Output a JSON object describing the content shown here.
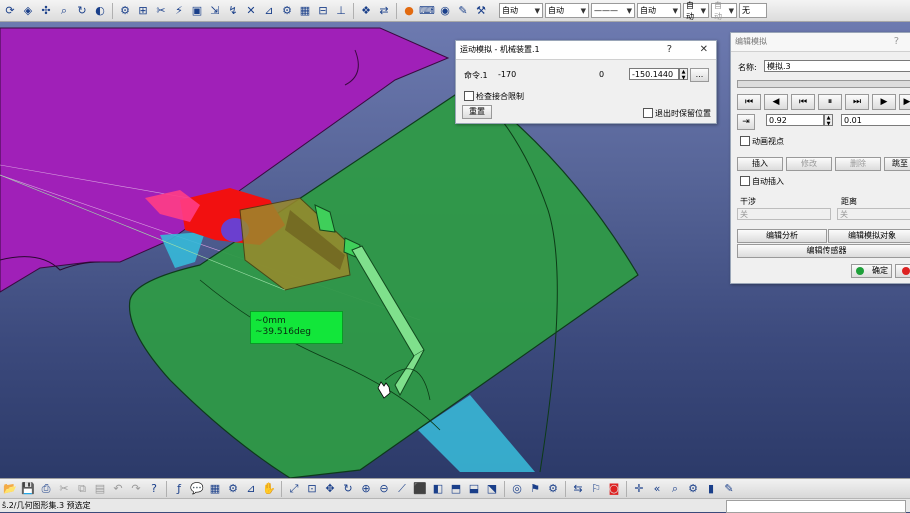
{
  "top_toolbar": {
    "icons": [
      "update-icon",
      "render-style-icon",
      "compass-icon",
      "zoom-fit-icon",
      "rotate-icon",
      "hide-show-icon",
      "assembly-icon",
      "constraint-icon",
      "snap-icon",
      "bolt-icon",
      "save-icon",
      "move-icon",
      "manipulate-icon",
      "check-clash-icon",
      "measure-icon",
      "gear-icon",
      "grid-icon",
      "tree-icon",
      "axis-icon",
      "catalog-icon",
      "swap-icon",
      "material-icon",
      "keyboard-icon",
      "apply-material-icon",
      "tools-icon"
    ],
    "dropdowns": [
      "自动",
      "自动",
      "———",
      "自动",
      "自动",
      "自动",
      "无"
    ]
  },
  "motion_dialog": {
    "title": "运动模拟 - 机械装置.1",
    "help": "?",
    "close": "✕",
    "command_label": "命令.1",
    "range_min": "-170",
    "range_max": "0",
    "value": "-150.1440",
    "more_button": "...",
    "check_limits": "检查接合限制",
    "reset_button": "重置",
    "keep_position": "退出时保留位置"
  },
  "edit_sim_panel": {
    "title": "编辑模拟",
    "help": "?",
    "name_label": "名称:",
    "name_value": "模拟.3",
    "player_buttons": [
      "⏮",
      "◀",
      "⏭",
      "⏸",
      "⏭",
      "▶",
      "▶"
    ],
    "step_value": "0.92",
    "step_value2": "0.01",
    "animate_viewpoint": "动画视点",
    "insert_button": "插入",
    "modify_button": "修改",
    "delete_button": "删除",
    "jump_button": "跳至",
    "auto_insert": "自动插入",
    "interference_label": "干涉",
    "interference_value": "关",
    "distance_label": "距离",
    "distance_value": "关",
    "edit_analysis": "编辑分析",
    "edit_sim_objects": "编辑模拟对象",
    "edit_sensors": "编辑传感器",
    "ok_button": "确定"
  },
  "viewport": {
    "measure_line1": "~0mm",
    "measure_line2": "~39.516deg"
  },
  "bottom_toolbar": {
    "icons": [
      "open-icon",
      "save-icon",
      "print-icon",
      "cut-icon",
      "copy-icon",
      "paste-icon",
      "undo-icon",
      "redo-icon",
      "whats-this-icon",
      "formula-icon",
      "comment-icon",
      "table-icon",
      "knowledge-icon",
      "measure-icon",
      "pan-icon",
      "fit-all-icon",
      "move-icon",
      "rotate-icon",
      "zoom-in-icon",
      "zoom-out-icon",
      "normal-view-icon",
      "iso-view-icon",
      "render-icon",
      "hide-icon",
      "swap-visible-icon",
      "sim-icon",
      "compile-icon",
      "replay-icon",
      "player-icon",
      "record-icon",
      "analysis-icon",
      "vcr-icon",
      "search-icon",
      "sensor-icon",
      "color-icon"
    ]
  },
  "status_bar": {
    "text": "ŝ.2/几何图形集.3 预选定"
  }
}
